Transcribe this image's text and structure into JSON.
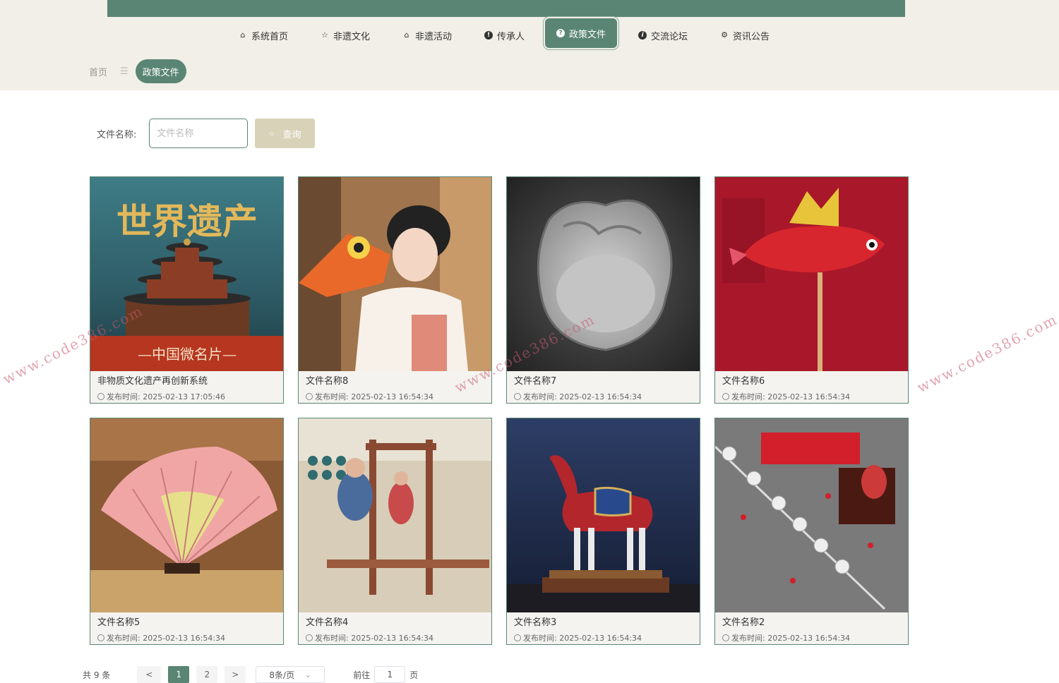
{
  "nav": {
    "items": [
      {
        "label": "系统首页",
        "icon": "home-icon",
        "glyph": "⌂"
      },
      {
        "label": "非遗文化",
        "icon": "star-icon",
        "glyph": "☆"
      },
      {
        "label": "非遗活动",
        "icon": "bag-icon",
        "glyph": "⌂"
      },
      {
        "label": "传承人",
        "icon": "exclamation-icon",
        "glyph": "!"
      },
      {
        "label": "政策文件",
        "icon": "question-icon",
        "glyph": "?"
      },
      {
        "label": "交流论坛",
        "icon": "info-icon",
        "glyph": "i"
      },
      {
        "label": "资讯公告",
        "icon": "gear-icon",
        "glyph": "⚙"
      }
    ],
    "active_index": 4
  },
  "breadcrumb": {
    "home": "首页",
    "separator": "☰",
    "current": "政策文件"
  },
  "search": {
    "label": "文件名称:",
    "placeholder": "文件名称",
    "value": "",
    "button": "查询"
  },
  "cards": [
    {
      "title": "非物质文化遗产再创新系统",
      "date": "发布时间: 2025-02-13 17:05:46",
      "pic_text": "世界遗产",
      "pic_sub": "—中国微名片—"
    },
    {
      "title": "文件名称8",
      "date": "发布时间: 2025-02-13 16:54:34"
    },
    {
      "title": "文件名称7",
      "date": "发布时间: 2025-02-13 16:54:34"
    },
    {
      "title": "文件名称6",
      "date": "发布时间: 2025-02-13 16:54:34"
    },
    {
      "title": "文件名称5",
      "date": "发布时间: 2025-02-13 16:54:34"
    },
    {
      "title": "文件名称4",
      "date": "发布时间: 2025-02-13 16:54:34"
    },
    {
      "title": "文件名称3",
      "date": "发布时间: 2025-02-13 16:54:34"
    },
    {
      "title": "文件名称2",
      "date": "发布时间: 2025-02-13 16:54:34"
    }
  ],
  "pagination": {
    "total": "共 9 条",
    "prev": "<",
    "pages": [
      "1",
      "2"
    ],
    "current": "1",
    "next": ">",
    "page_size": "8条/页",
    "goto_label": "前往",
    "goto_value": "1",
    "goto_suffix": "页"
  },
  "watermark": "www.code386.com",
  "colors": {
    "primary": "#5a8574",
    "band": "#f1efe7",
    "button": "#d8d2b8"
  }
}
